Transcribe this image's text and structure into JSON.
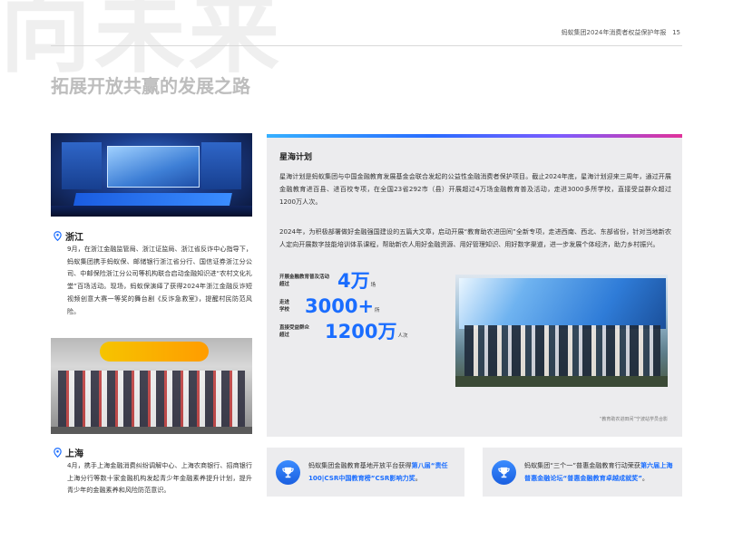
{
  "watermark": "向未来",
  "header": {
    "running_title": "蚂蚁集团2024年消费者权益保护年报",
    "page_number": "15"
  },
  "section_title": "拓展开放共赢的发展之路",
  "locations": [
    {
      "name": "浙江",
      "text": "9月，在浙江金融监管局、浙江证监局、浙江省反诈中心指导下，蚂蚁集团携手蚂蚁保、邮储银行浙江省分行、国信证券浙江分公司、中邮保险浙江分公司等机构联合启动金融知识进“农村文化礼堂”百场活动。现场，蚂蚁保演绎了获得2024年浙江金融反诈短视频创意大赛一等奖的舞台剧《反诈急救室》，提醒村民防范风险。"
    },
    {
      "name": "上海",
      "text": "4月，携手上海金融消费纠纷调解中心、上海农商银行、招商银行上海分行等数十家金融机构发起青少年金融素养提升计划，提升青少年的金融素养和风险防范意识。"
    }
  ],
  "panel": {
    "title": "星海计划",
    "paragraph1": "星海计划是蚂蚁集团与中国金融教育发展基金会联合发起的公益性金融消费者保护项目。截止2024年底，星海计划迎来三周年，通过开展金融教育进百县、进百校专项，在全国23省292市（县）开展超过4万场金融教育普及活动，走进3000多所学校，直接受益群众超过1200万人次。",
    "paragraph2": "2024年，为积极部署做好金融强国建设的五篇大文章，启动开展“教育助农进田间”全新专项，走进西南、西北、东部省份，针对当地新农人定向开展数字技能培训体系课程，帮助新农人用好金融资源、用好管理知识、用好数字渠道，进一步发展个体经济，助力乡村振兴。",
    "stats": [
      {
        "label_line1": "开展金融教育普及活动",
        "label_line2": "超过",
        "value": "4万",
        "unit": "场"
      },
      {
        "label_line1": "走进",
        "label_line2": "学校",
        "value": "3000+",
        "unit": "所"
      },
      {
        "label_line1": "直接受益群众",
        "label_line2": "超过",
        "value": "1200万",
        "unit": "人次"
      }
    ],
    "photo_caption": "“教育助农进田间”宁波站学员合影"
  },
  "awards": [
    {
      "icon": "trophy-icon",
      "text_before": "蚂蚁集团金融教育基地开放平台获得",
      "highlight": "第八届“责任100|CSR中国教育榜”CSR影响力奖",
      "text_after": "。"
    },
    {
      "icon": "trophy-icon",
      "text_before": "蚂蚁集团“三个一”普惠金融教育行动荣获",
      "highlight": "第六届上海普惠金融论坛“普惠金融教育卓越成就奖”",
      "text_after": "。"
    }
  ],
  "colors": {
    "accent": "#1a6dff",
    "panel_bg": "#ececee",
    "title_grey": "#bdbdbd"
  }
}
